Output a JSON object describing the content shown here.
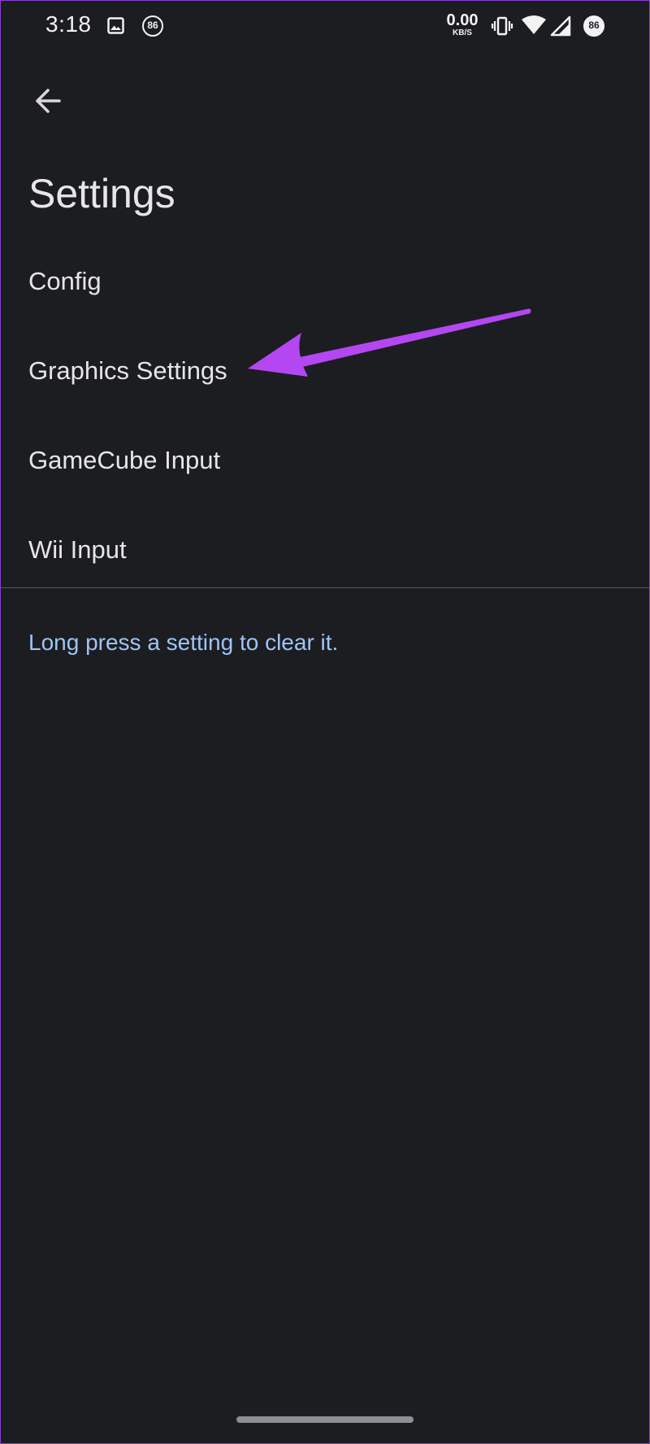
{
  "status_bar": {
    "time": "3:18",
    "notification_badge": "86",
    "net_speed_value": "0.00",
    "net_speed_unit": "KB/S",
    "battery_level": "86",
    "icons": [
      "image-icon",
      "vibrate-icon",
      "wifi-icon",
      "signal-icon"
    ]
  },
  "app_bar": {
    "back_icon": "arrow-back-icon",
    "title": "Settings"
  },
  "settings": {
    "items": [
      {
        "label": "Config"
      },
      {
        "label": "Graphics Settings"
      },
      {
        "label": "GameCube Input"
      },
      {
        "label": "Wii Input"
      }
    ],
    "hint": "Long press a setting to clear it."
  },
  "colors": {
    "background": "#1c1d21",
    "text_primary": "#e6e6e8",
    "hint_accent": "#9ec4f6",
    "annotation_arrow": "#b447f2",
    "frame_border": "#8a3fd6"
  }
}
